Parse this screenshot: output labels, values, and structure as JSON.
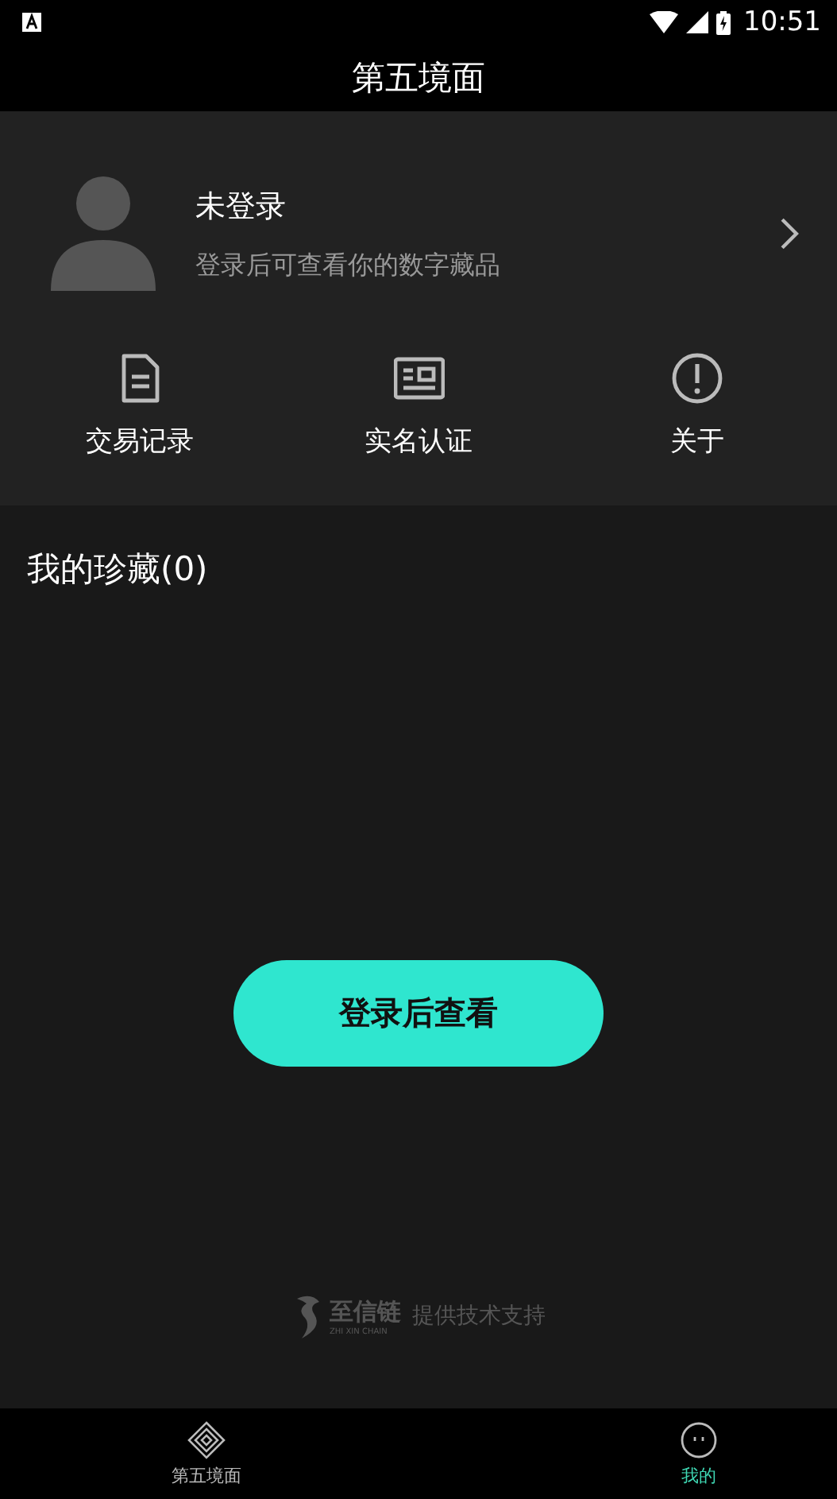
{
  "status_bar": {
    "time": "10:51"
  },
  "title": "第五境面",
  "profile": {
    "name": "未登录",
    "hint": "登录后可查看你的数字藏品"
  },
  "shortcuts": [
    {
      "kind": "document",
      "label": "交易记录"
    },
    {
      "kind": "id-card",
      "label": "实名认证"
    },
    {
      "kind": "info",
      "label": "关于"
    }
  ],
  "collection": {
    "heading": "我的珍藏(0)",
    "button": "登录后查看"
  },
  "footer": {
    "brand": "至信链",
    "brand_sub": "ZHI XIN CHAIN",
    "text": "提供技术支持"
  },
  "nav": [
    {
      "kind": "home",
      "label": "第五境面",
      "selected": false
    },
    {
      "kind": "me",
      "label": "我的",
      "selected": true
    }
  ]
}
